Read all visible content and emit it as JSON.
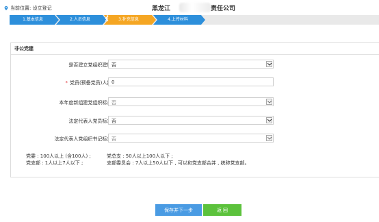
{
  "header": {
    "location": "当前位置: 设立登记",
    "company_prefix": "黑龙江",
    "company_suffix": "责任公司"
  },
  "steps": [
    {
      "label": "1.基本信息",
      "state": "done"
    },
    {
      "label": "2.人员信息",
      "state": "done"
    },
    {
      "label": "3.补充信息",
      "state": "active"
    },
    {
      "label": "4.上传材料",
      "state": "todo"
    }
  ],
  "panel": {
    "title": "非公党建",
    "fields": [
      {
        "label": "是否建立党组织建制 :",
        "value": "否",
        "type": "select",
        "required": false,
        "disabled": false
      },
      {
        "label": "党员(预备党员)人数 :",
        "value": "0",
        "type": "input",
        "required": true,
        "disabled": false
      },
      {
        "label": "本年度新组建党组织标志 :",
        "value": "否",
        "type": "select",
        "required": false,
        "disabled": true
      },
      {
        "label": "法定代表人党员标志 :",
        "value": "否",
        "type": "select",
        "required": false,
        "disabled": false
      },
      {
        "label": "法定代表人党组织书记标志 :",
        "value": "否",
        "type": "select",
        "required": false,
        "disabled": true
      }
    ],
    "notes": {
      "line1_left": "党委 : 100人以上 (含100人) ;",
      "line1_right": "党总支 : 50人以上100人以下 ;",
      "line2_left": "党支部 : 1人以上7人以下 ;",
      "line2_right": "支部委员会 : 7人以上50人以下 , 可以和党支部合并 , 统称党支部。"
    }
  },
  "buttons": {
    "save_next": "保存并下一步",
    "back": "返 回"
  },
  "colors": {
    "step_done": "#2d8fdb",
    "step_active": "#f5a623",
    "step_todo": "#2d8fdb",
    "save_button": "#4a9be3",
    "back_button": "#5cc23c",
    "required": "#e0343a"
  }
}
